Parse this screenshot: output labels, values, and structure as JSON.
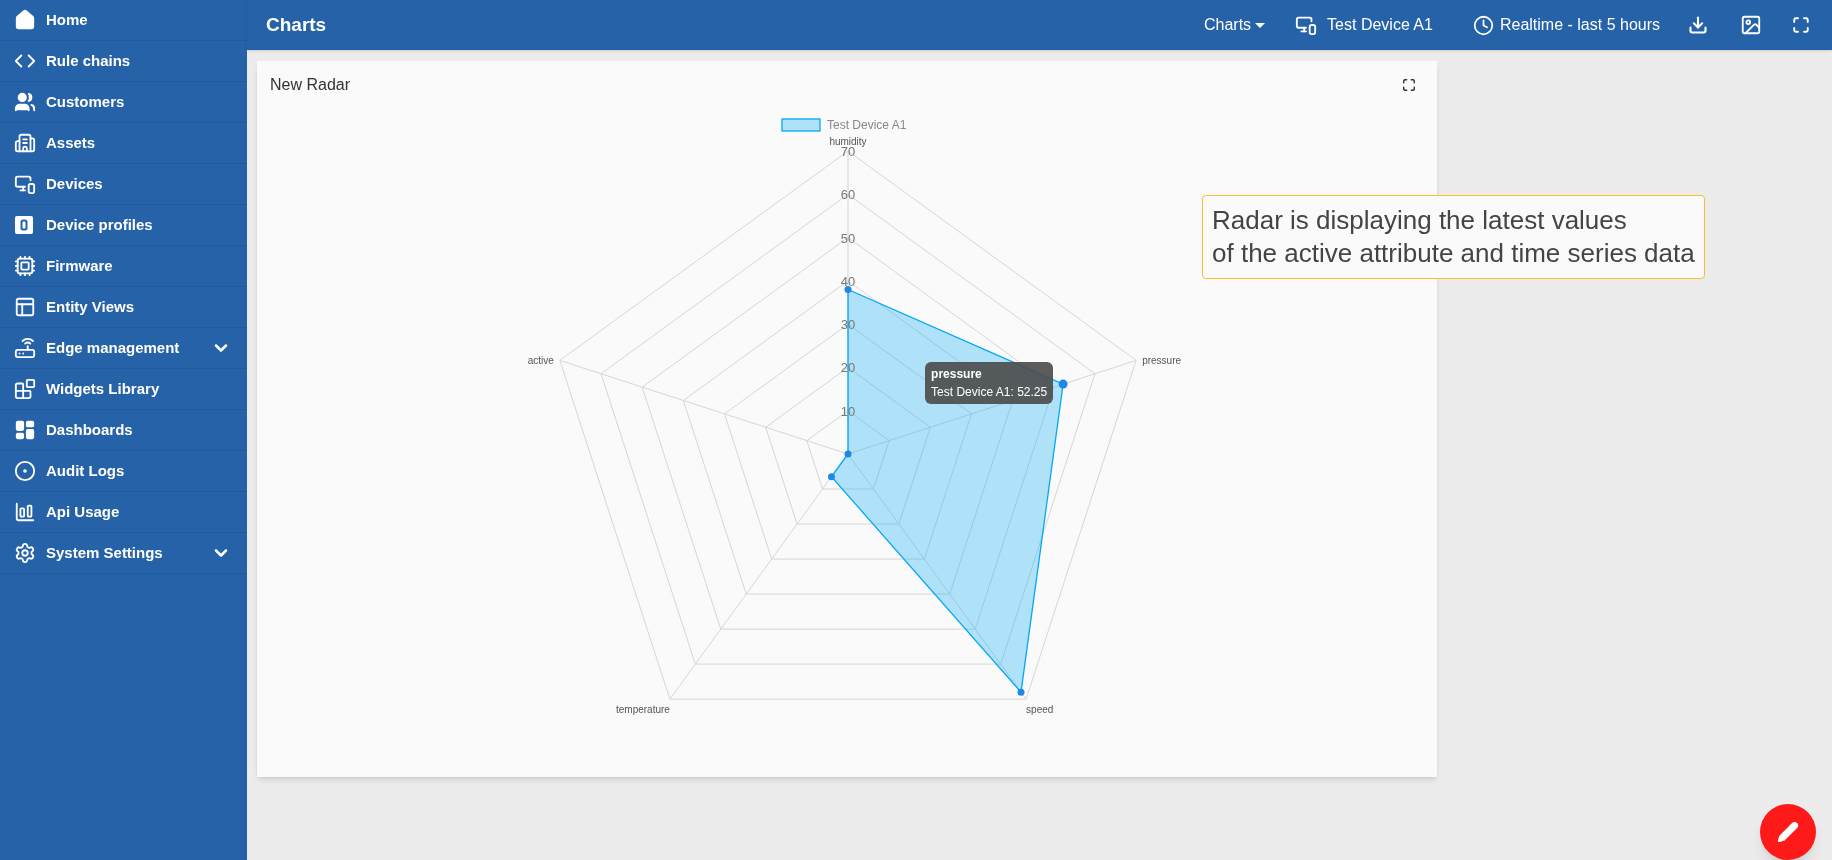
{
  "sidebar": {
    "items": [
      {
        "label": "Home",
        "kind": "link"
      },
      {
        "label": "Rule chains",
        "kind": "link"
      },
      {
        "label": "Customers",
        "kind": "link"
      },
      {
        "label": "Assets",
        "kind": "link"
      },
      {
        "label": "Devices",
        "kind": "link"
      },
      {
        "label": "Device profiles",
        "kind": "link"
      },
      {
        "label": "Firmware",
        "kind": "link"
      },
      {
        "label": "Entity Views",
        "kind": "link"
      },
      {
        "label": "Edge management",
        "kind": "group"
      },
      {
        "label": "Widgets Library",
        "kind": "link"
      },
      {
        "label": "Dashboards",
        "kind": "link"
      },
      {
        "label": "Audit Logs",
        "kind": "link"
      },
      {
        "label": "Api Usage",
        "kind": "link"
      },
      {
        "label": "System Settings",
        "kind": "group"
      }
    ]
  },
  "header": {
    "title": "Charts",
    "state_selector": "Charts",
    "entity": "Test Device A1",
    "timewindow": "Realtime - last 5 hours"
  },
  "widget": {
    "title": "New Radar",
    "chart_data": {
      "type": "radar",
      "categories": [
        "humidity",
        "pressure",
        "speed",
        "temperature",
        "active"
      ],
      "series": [
        {
          "name": "Test Device A1",
          "color": "#03a9f4",
          "values": [
            38,
            52.25,
            68,
            6.5,
            0
          ]
        }
      ],
      "ylim": [
        0,
        70
      ],
      "yticks": [
        10,
        20,
        30,
        40,
        50,
        60,
        70
      ]
    },
    "tooltip": {
      "title": "pressure",
      "text": "Test Device A1: 52.25"
    }
  },
  "note": {
    "lines": [
      "Radar is displaying the latest values",
      "of the active attribute and time series data"
    ]
  }
}
